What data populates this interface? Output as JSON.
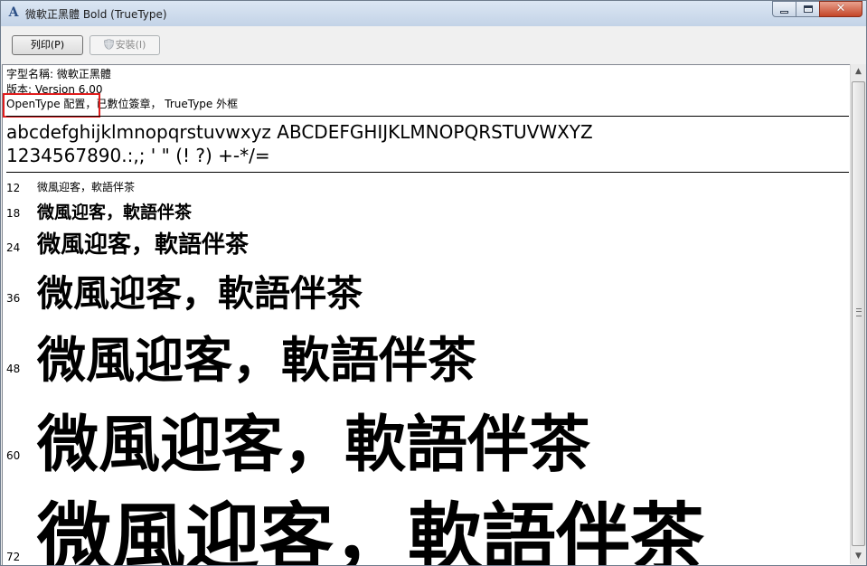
{
  "window": {
    "title": "微軟正黑體 Bold (TrueType)",
    "app_icon": "font-a-icon",
    "controls": {
      "minimize": "minimize-icon",
      "maximize": "maximize-icon",
      "close": "✕"
    }
  },
  "toolbar": {
    "print_label": "列印(P)",
    "install_label": "安裝(I)",
    "install_icon": "shield-icon"
  },
  "info": {
    "font_name": "字型名稱: 微軟正黑體",
    "version": "版本: Version 6.00",
    "features_highlight": "OpenType 配置，",
    "features_rest": "已數位簽章， TrueType 外框",
    "highlight_color": "#e11d1d"
  },
  "samples": {
    "alphabet": "abcdefghijklmnopqrstuvwxyz ABCDEFGHIJKLMNOPQRSTUVWXYZ",
    "digits": "1234567890.:,; ' \" (! ?) +-*/=",
    "sizes": [
      {
        "size": "12",
        "text": "微風迎客，軟語伴茶"
      },
      {
        "size": "18",
        "text": "微風迎客，軟語伴茶"
      },
      {
        "size": "24",
        "text": "微風迎客，軟語伴茶"
      },
      {
        "size": "36",
        "text": "微風迎客，軟語伴茶"
      },
      {
        "size": "48",
        "text": "微風迎客，軟語伴茶"
      },
      {
        "size": "60",
        "text": "微風迎客，軟語伴茶"
      },
      {
        "size": "72",
        "text": "微風迎客，軟語伴茶"
      }
    ]
  }
}
